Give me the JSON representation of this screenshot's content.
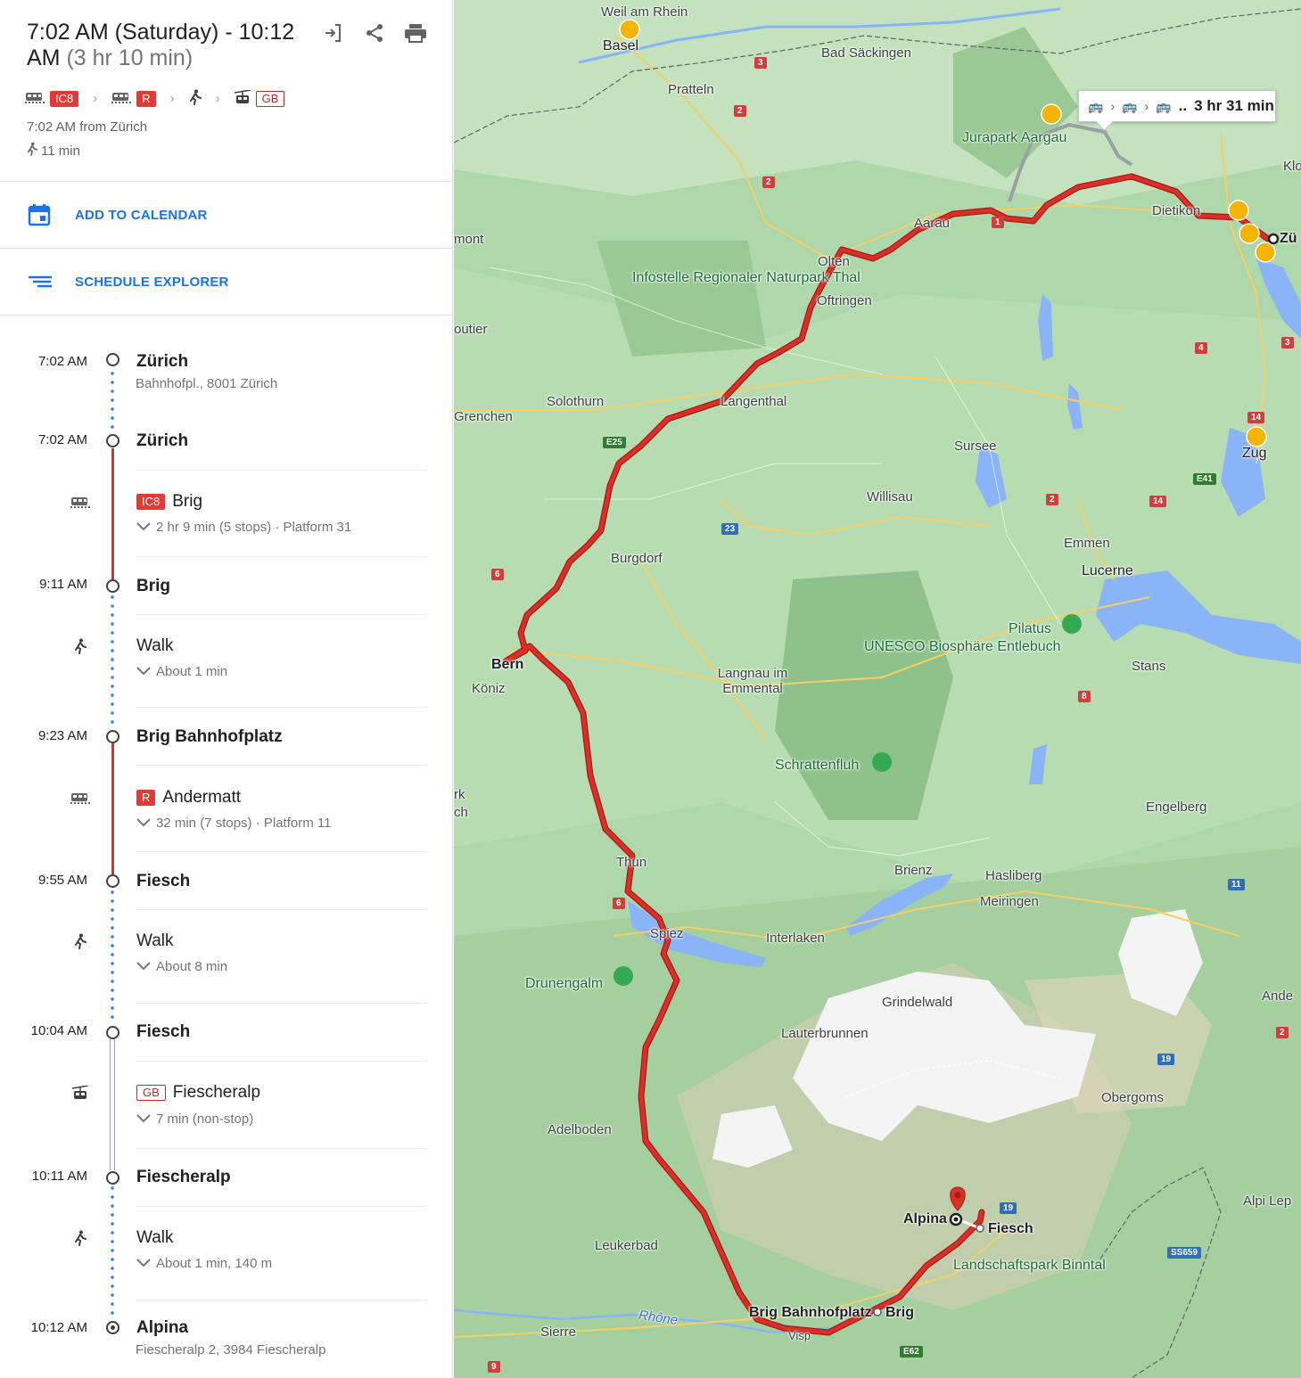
{
  "header": {
    "title_time": "7:02 AM (Saturday) - 10:12 AM",
    "title_duration": "(3 hr 10 min)",
    "summary_badges": [
      "IC8",
      "R",
      "GB"
    ],
    "depart_text": "7:02 AM from Zürich",
    "walk_total": "11 min",
    "icons": [
      "send-to-phone-icon",
      "share-icon",
      "print-icon"
    ]
  },
  "actions": {
    "calendar_label": "ADD TO CALENDAR",
    "schedule_label": "SCHEDULE EXPLORER"
  },
  "timeline": {
    "stops": [
      {
        "time": "7:02 AM",
        "name": "Zürich",
        "address": "Bahnhofpl., 8001 Zürich"
      },
      {
        "time": "7:02 AM",
        "name": "Zürich"
      },
      {
        "time": "9:11 AM",
        "name": "Brig"
      },
      {
        "time": "9:23 AM",
        "name": "Brig Bahnhofplatz"
      },
      {
        "time": "9:55 AM",
        "name": "Fiesch"
      },
      {
        "time": "10:04 AM",
        "name": "Fiesch"
      },
      {
        "time": "10:11 AM",
        "name": "Fiescheralp"
      },
      {
        "time": "10:12 AM",
        "name": "Alpina",
        "address": "Fiescheralp 2, 3984 Fiescheralp"
      }
    ],
    "legs": [
      {
        "mode": "train",
        "badge": "IC8",
        "headsign": "Brig",
        "detail": "2 hr 9 min (5 stops) · Platform 31"
      },
      {
        "mode": "walk",
        "headsign": "Walk",
        "detail": "About 1 min"
      },
      {
        "mode": "train",
        "badge": "R",
        "headsign": "Andermatt",
        "detail": "32 min (7 stops) · Platform 11"
      },
      {
        "mode": "walk",
        "headsign": "Walk",
        "detail": "About 8 min"
      },
      {
        "mode": "gondola",
        "badge": "GB",
        "headsign": "Fiescheralp",
        "detail": "7 min (non-stop)"
      },
      {
        "mode": "walk",
        "headsign": "Walk",
        "detail": "About 1 min, 140 m"
      }
    ]
  },
  "map": {
    "alt_route_time": "3 hr 31 min",
    "alt_route_more": "..",
    "route_color": "#d93025",
    "labels": {
      "basel": "Basel",
      "weil": "Weil am Rhein",
      "pratteln": "Pratteln",
      "badsack": "Bad Säckingen",
      "jurapark": "Jurapark Aargau",
      "aarau": "Aarau",
      "dietikon": "Dietikon",
      "zurich": "Zü",
      "olten": "Olten",
      "oftringen": "Oftringen",
      "infostelle": "Infostelle Regionaler Naturpark Thal",
      "solothurn": "Solothurn",
      "grenchen": "Grenchen",
      "langenthal": "Langenthal",
      "sursee": "Sursee",
      "willisau": "Willisau",
      "zug": "Zug",
      "emmen": "Emmen",
      "lucerne": "Lucerne",
      "burgdorf": "Burgdorf",
      "bern": "Bern",
      "koniz": "Köniz",
      "langnau": "Langnau im Emmental",
      "unesco": "UNESCO Biosphäre Entlebuch",
      "pilatus": "Pilatus",
      "stans": "Stans",
      "schratten": "Schrattenfluh",
      "engelberg": "Engelberg",
      "thun": "Thun",
      "brienz": "Brienz",
      "hasliberg": "Hasliberg",
      "meiringen": "Meiringen",
      "spiez": "Spiez",
      "interlaken": "Interlaken",
      "drunengalm": "Drunengalm",
      "grindelwald": "Grindelwald",
      "lauterbrunnen": "Lauterbrunnen",
      "adelboden": "Adelboden",
      "obergoms": "Obergoms",
      "leukerbad": "Leukerbad",
      "alpina": "Alpina",
      "fiesch": "Fiesch",
      "binntal": "Landschaftspark Binntal",
      "brigbhf": "Brig Bahnhofplatz",
      "brig": "Brig",
      "visp": "Visp",
      "sierre": "Sierre",
      "rhone": "Rhône",
      "alpilep": "Alpi Lep",
      "ande": "Ande",
      "mont": "mont",
      "routier": "outier",
      "rk": "rk",
      "ch": "ch",
      "klo": "Klo"
    },
    "shields": {
      "a3": "3",
      "a2a": "2",
      "a2b": "2",
      "a1": "1",
      "e25": "E25",
      "a6a": "6",
      "a23": "23",
      "a2c": "2",
      "a14a": "14",
      "a14b": "14",
      "e41": "E41",
      "a4": "4",
      "a3b": "3",
      "a8": "8",
      "a6b": "6",
      "a11": "11",
      "a19": "19",
      "a19b": "19",
      "ss659": "SS659",
      "e62": "E62",
      "a9": "9",
      "a2d": "2"
    }
  }
}
